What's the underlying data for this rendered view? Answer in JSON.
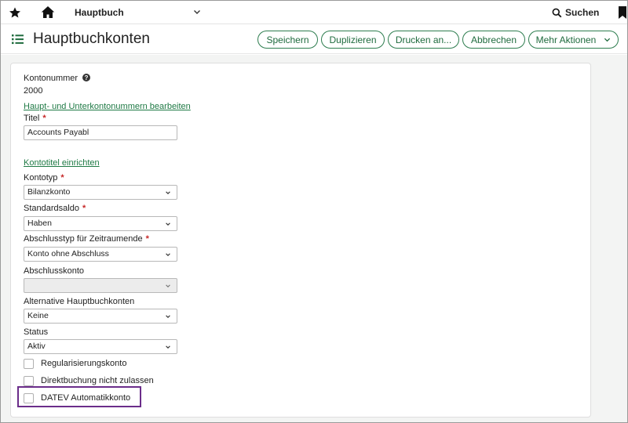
{
  "topbar": {
    "module": "Hauptbuch",
    "search_label": "Suchen"
  },
  "header": {
    "title": "Hauptbuchkonten",
    "buttons": {
      "save": "Speichern",
      "duplicate": "Duplizieren",
      "print": "Drucken an...",
      "cancel": "Abbrechen",
      "more": "Mehr Aktionen"
    }
  },
  "form": {
    "account_number_label": "Kontonummer",
    "account_number_value": "2000",
    "edit_numbers_link": "Haupt- und Unterkontonummern bearbeiten",
    "title_label": "Titel",
    "title_value": "Accounts Payabl",
    "setup_titles_link": "Kontotitel einrichten",
    "account_type_label": "Kontotyp",
    "account_type_value": "Bilanzkonto",
    "normal_balance_label": "Standardsaldo",
    "normal_balance_value": "Haben",
    "closing_type_label": "Abschlusstyp für Zeitraumende",
    "closing_type_value": "Konto ohne Abschluss",
    "closing_account_label": "Abschlusskonto",
    "closing_account_value": "",
    "alt_gl_label": "Alternative Hauptbuchkonten",
    "alt_gl_value": "Keine",
    "status_label": "Status",
    "status_value": "Aktiv",
    "checkboxes": [
      {
        "label": "Regularisierungskonto",
        "checked": false
      },
      {
        "label": "Direktbuchung nicht zulassen",
        "checked": false
      },
      {
        "label": "DATEV Automatikkonto",
        "checked": false
      }
    ],
    "required_marker": "*"
  },
  "colors": {
    "accent_green": "#1f6b3e",
    "required_red": "#c62828",
    "highlight_purple": "#6b2d8a"
  },
  "icons": {
    "star": "star-icon",
    "home": "home-icon",
    "search": "search-icon",
    "bookmark": "bookmark-icon",
    "list": "list-icon",
    "help": "help-circle-icon",
    "dropdown": "chevron-down-icon"
  }
}
